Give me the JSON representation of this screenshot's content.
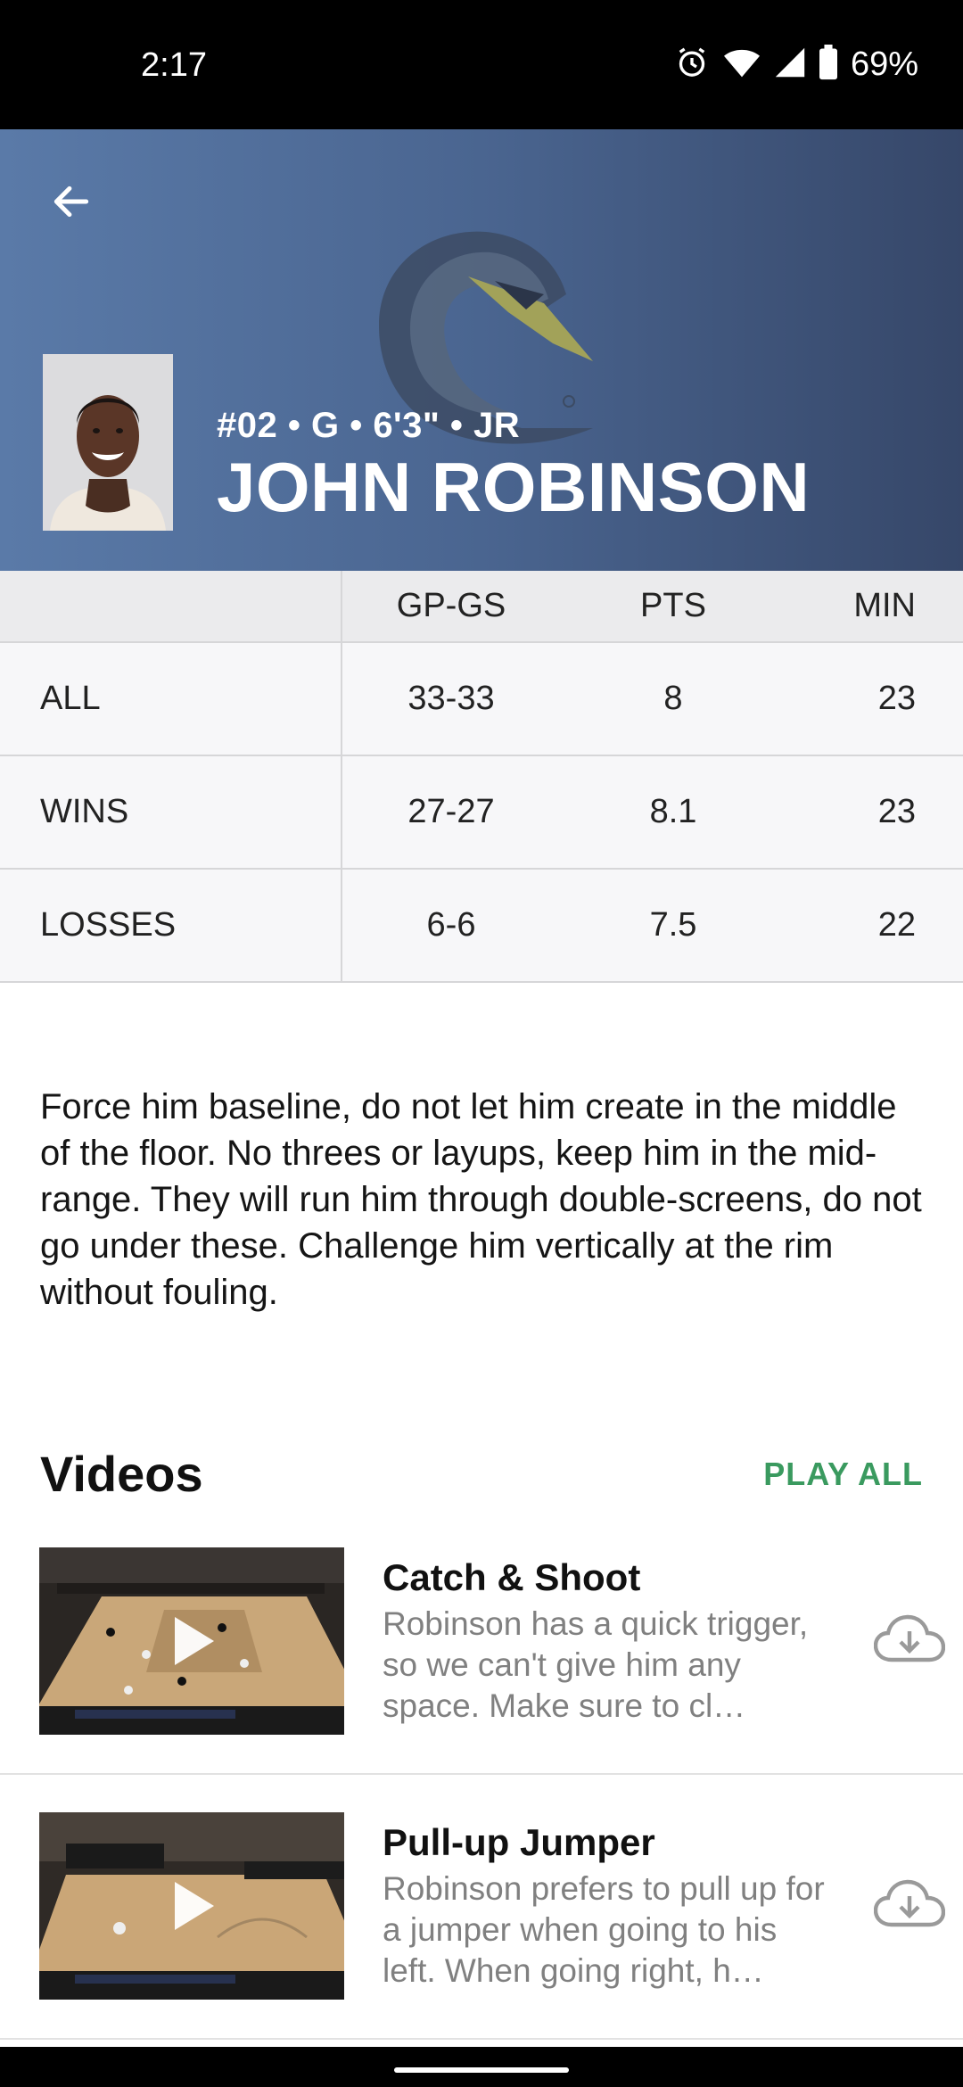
{
  "status_bar": {
    "time": "2:17",
    "battery": "69%",
    "icons": [
      "alarm-icon",
      "wifi-icon",
      "signal-icon",
      "battery-icon"
    ]
  },
  "header": {
    "back_icon": "arrow-left-icon",
    "player_meta": "#02 • G • 6'3\" • JR",
    "player_name": "JOHN ROBINSON"
  },
  "stats": {
    "columns": [
      "",
      "GP-GS",
      "PTS",
      "MIN"
    ],
    "rows": [
      {
        "label": "ALL",
        "gp_gs": "33-33",
        "pts": "8",
        "min": "23"
      },
      {
        "label": "WINS",
        "gp_gs": "27-27",
        "pts": "8.1",
        "min": "23"
      },
      {
        "label": "LOSSES",
        "gp_gs": "6-6",
        "pts": "7.5",
        "min": "22"
      }
    ]
  },
  "description": "Force him baseline, do not let him create in the middle of the floor. No threes or layups, keep him in the mid-range. They will run him through double-screens, do not go under these. Challenge him vertically at the rim without fouling.",
  "videos": {
    "title": "Videos",
    "play_all": "PLAY ALL",
    "items": [
      {
        "title": "Catch & Shoot",
        "desc": "Robinson has a quick trigger, so we can't give him any space. Make sure to cl…"
      },
      {
        "title": "Pull-up Jumper",
        "desc": "Robinson prefers to pull up for a jumper when going to his left. When going right, h…"
      }
    ]
  },
  "colors": {
    "accent_green": "#3a9a5f",
    "header_gradient_start": "#5a7aa8",
    "header_gradient_end": "#364769"
  }
}
